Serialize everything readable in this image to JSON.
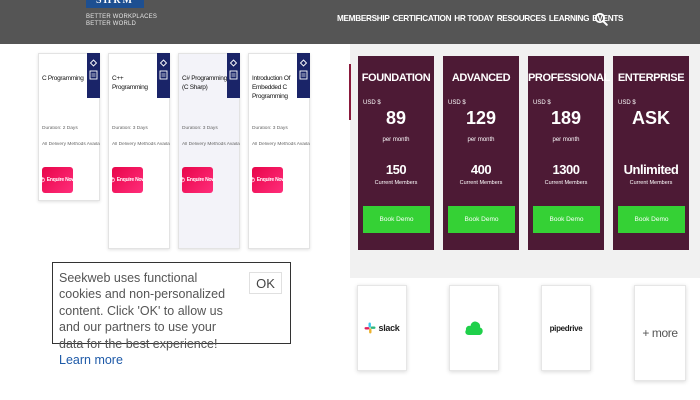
{
  "header": {
    "logo": {
      "mark": "SHRM",
      "tagline1": "BETTER WORKPLACES",
      "tagline2": "BETTER WORLD"
    },
    "nav": [
      "MEMBERSHIP",
      "CERTIFICATION",
      "HR TODAY",
      "RESOURCES",
      "LEARNING",
      "EVENTS"
    ]
  },
  "courses": [
    {
      "title": "C Programming",
      "duration": "Duration: 2 Days",
      "methods": "All Delivery Methods Available: Yes",
      "cta": "Enquire Now"
    },
    {
      "title": "C++ Programming",
      "duration": "Duration: 3 Days",
      "methods": "All Delivery Methods Available: Yes",
      "cta": "Enquire Now"
    },
    {
      "title": "C# Programming (C Sharp)",
      "duration": "Duration: 3 Days",
      "methods": "All Delivery Methods Available: Yes",
      "cta": "Enquire Now"
    },
    {
      "title": "Introduction Of Embedded C Programming",
      "duration": "Duration: 3 Days",
      "methods": "All Delivery Methods Available: Yes",
      "cta": "Enquire Now"
    }
  ],
  "plans": [
    {
      "name": "FOUNDATION",
      "currency": "USD $",
      "price": "89",
      "period": "per month",
      "members": "150",
      "members_label": "Current Members",
      "cta": "Book Demo"
    },
    {
      "name": "ADVANCED",
      "currency": "USD $",
      "price": "129",
      "period": "per month",
      "members": "400",
      "members_label": "Current Members",
      "cta": "Book Demo"
    },
    {
      "name": "PROFESSIONAL",
      "currency": "USD $",
      "price": "189",
      "period": "per month",
      "members": "1300",
      "members_label": "Current Members",
      "cta": "Book Demo"
    },
    {
      "name": "ENTERPRISE",
      "currency": "USD $",
      "price": "ASK",
      "period": "",
      "members": "Unlimited",
      "members_label": "Current Members",
      "cta": "Book Demo"
    }
  ],
  "integrations": {
    "slack": "slack",
    "pipedrive": "pipedrive",
    "more": "+ more"
  },
  "cookie": {
    "text": "Seekweb uses functional cookies and non-personalized content. Click 'OK' to allow us and our partners to use your data for the best experience!",
    "link": "Learn more",
    "ok": "OK"
  },
  "colors": {
    "header_bg": "#555555",
    "plan_bg": "#4d1a35",
    "demo_green": "#35d135",
    "enquire_pink": "#e8064a",
    "badge_navy": "#1a2468"
  }
}
